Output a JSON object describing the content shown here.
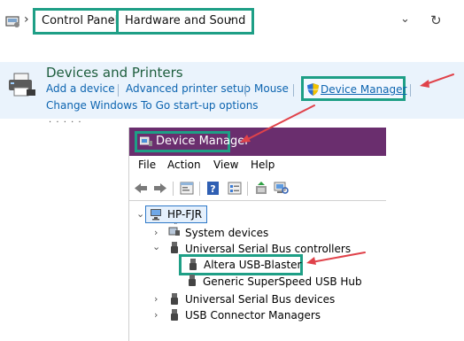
{
  "address_bar": {
    "crumbs": [
      "Control Panel",
      "Hardware and Sound"
    ],
    "dropdown_icon": "chevron-down-icon",
    "refresh_icon": "refresh-icon"
  },
  "panel": {
    "title": "Devices and Printers",
    "links": [
      "Add a device",
      "Advanced printer setup",
      "Mouse",
      "Device Manager",
      "Change Windows To Go start-up options"
    ]
  },
  "device_manager": {
    "title": "Device Manager",
    "menu": [
      "File",
      "Action",
      "View",
      "Help"
    ],
    "tree": {
      "root": "HP-FJR",
      "items": {
        "system_devices": "System devices",
        "usb_controllers": "Universal Serial Bus controllers",
        "altera": "Altera USB-Blaster",
        "generic_hub": "Generic SuperSpeed USB Hub",
        "usb_devices": "Universal Serial Bus devices",
        "usb_connector": "USB Connector Managers"
      }
    }
  },
  "colors": {
    "highlight_box": "#1e9f86",
    "annotation_arrow": "#e0424a",
    "titlebar": "#6a2e6e",
    "link": "#0c64b0",
    "panel_bg": "#eaf3fc"
  }
}
